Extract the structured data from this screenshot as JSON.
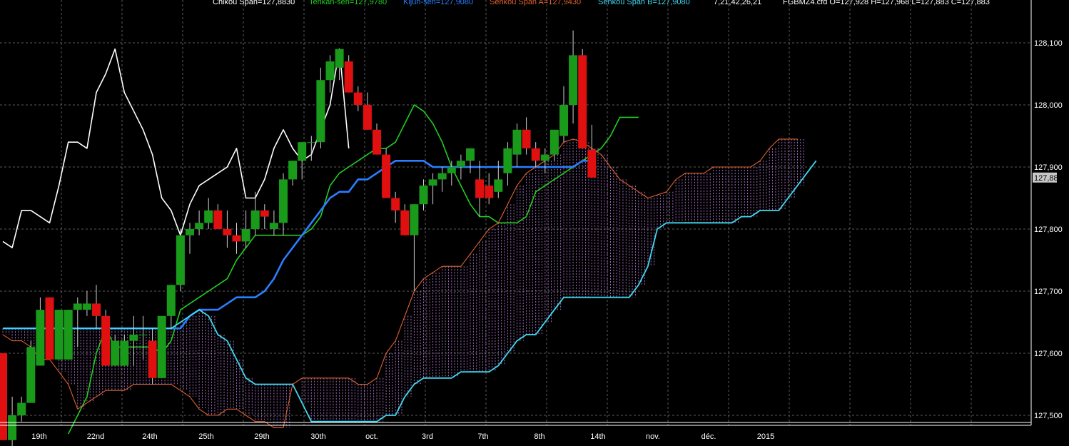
{
  "legend": {
    "chikou": "Chikou Span=127,8830",
    "tenkan": "Tenkan-sen=127,9780",
    "kijun": "Kijun-sen=127,9080",
    "senkou_a": "Senkou Span A=127,9430",
    "senkou_b": "Senkou Span B=127,9080",
    "params": "7,21,42,26,21",
    "ohlc": "FGBMZ4.cfd O=127,928 H=127,968 L=127,883 C=127,883"
  },
  "colors": {
    "background": "#000000",
    "grid": "#5a5a5a",
    "up_candle": "#1a9a1a",
    "down_candle": "#e01010",
    "chikou": "#ffffff",
    "tenkan": "#22cc22",
    "kijun": "#2a7fff",
    "senkou_a": "#e06030",
    "senkou_b": "#40d8f0",
    "cloud_hatch": "#c080e0",
    "axis_text": "#ffffff",
    "last_price_bg": "#c8c8c8"
  },
  "chart_data": {
    "type": "candlestick",
    "instrument": "FGBMZ4.cfd",
    "ylim": [
      127.485,
      128.15
    ],
    "y_ticks": [
      "128,100",
      "128,000",
      "127,900",
      "127,800",
      "127,700",
      "127,600",
      "127,500"
    ],
    "last_price_label": "127,883",
    "x_labels": [
      "19th",
      "22nd",
      "24th",
      "25th",
      "29th",
      "30th",
      "oct.",
      "3rd",
      "7th",
      "8th",
      "14th",
      "nov.",
      "déc.",
      "2015"
    ],
    "grid": true,
    "candles": [
      {
        "o": 127.6,
        "h": 127.6,
        "l": 127.46,
        "c": 127.46
      },
      {
        "o": 127.46,
        "h": 127.53,
        "l": 127.43,
        "c": 127.5
      },
      {
        "o": 127.5,
        "h": 127.53,
        "l": 127.49,
        "c": 127.52
      },
      {
        "o": 127.52,
        "h": 127.62,
        "l": 127.52,
        "c": 127.61
      },
      {
        "o": 127.58,
        "h": 127.69,
        "l": 127.58,
        "c": 127.67
      },
      {
        "o": 127.69,
        "h": 127.69,
        "l": 127.59,
        "c": 127.59
      },
      {
        "o": 127.59,
        "h": 127.67,
        "l": 127.59,
        "c": 127.67
      },
      {
        "o": 127.59,
        "h": 127.67,
        "l": 127.59,
        "c": 127.67
      },
      {
        "o": 127.67,
        "h": 127.69,
        "l": 127.61,
        "c": 127.68
      },
      {
        "o": 127.67,
        "h": 127.7,
        "l": 127.66,
        "c": 127.68
      },
      {
        "o": 127.68,
        "h": 127.71,
        "l": 127.64,
        "c": 127.66
      },
      {
        "o": 127.66,
        "h": 127.67,
        "l": 127.58,
        "c": 127.58
      },
      {
        "o": 127.58,
        "h": 127.63,
        "l": 127.58,
        "c": 127.62
      },
      {
        "o": 127.58,
        "h": 127.63,
        "l": 127.58,
        "c": 127.62
      },
      {
        "o": 127.62,
        "h": 127.66,
        "l": 127.58,
        "c": 127.63
      },
      {
        "o": 127.63,
        "h": 127.66,
        "l": 127.59,
        "c": 127.63
      },
      {
        "o": 127.62,
        "h": 127.64,
        "l": 127.55,
        "c": 127.56
      },
      {
        "o": 127.56,
        "h": 127.66,
        "l": 127.56,
        "c": 127.66
      },
      {
        "o": 127.66,
        "h": 127.71,
        "l": 127.64,
        "c": 127.71
      },
      {
        "o": 127.71,
        "h": 127.8,
        "l": 127.7,
        "c": 127.79
      },
      {
        "o": 127.79,
        "h": 127.81,
        "l": 127.76,
        "c": 127.8
      },
      {
        "o": 127.8,
        "h": 127.83,
        "l": 127.79,
        "c": 127.81
      },
      {
        "o": 127.81,
        "h": 127.85,
        "l": 127.8,
        "c": 127.83
      },
      {
        "o": 127.83,
        "h": 127.84,
        "l": 127.8,
        "c": 127.8
      },
      {
        "o": 127.8,
        "h": 127.83,
        "l": 127.77,
        "c": 127.79
      },
      {
        "o": 127.79,
        "h": 127.81,
        "l": 127.76,
        "c": 127.78
      },
      {
        "o": 127.78,
        "h": 127.83,
        "l": 127.77,
        "c": 127.8
      },
      {
        "o": 127.8,
        "h": 127.86,
        "l": 127.79,
        "c": 127.83
      },
      {
        "o": 127.83,
        "h": 127.84,
        "l": 127.8,
        "c": 127.82
      },
      {
        "o": 127.8,
        "h": 127.83,
        "l": 127.79,
        "c": 127.81
      },
      {
        "o": 127.81,
        "h": 127.89,
        "l": 127.79,
        "c": 127.88
      },
      {
        "o": 127.88,
        "h": 127.91,
        "l": 127.87,
        "c": 127.91
      },
      {
        "o": 127.91,
        "h": 127.94,
        "l": 127.88,
        "c": 127.94
      },
      {
        "o": 127.94,
        "h": 127.95,
        "l": 127.91,
        "c": 127.94
      },
      {
        "o": 127.94,
        "h": 128.06,
        "l": 127.93,
        "c": 128.04
      },
      {
        "o": 128.04,
        "h": 128.08,
        "l": 128.02,
        "c": 128.07
      },
      {
        "o": 128.06,
        "h": 128.09,
        "l": 128.04,
        "c": 128.09
      },
      {
        "o": 128.07,
        "h": 128.08,
        "l": 128.02,
        "c": 128.02
      },
      {
        "o": 128.02,
        "h": 128.03,
        "l": 127.99,
        "c": 128.0
      },
      {
        "o": 128.0,
        "h": 128.02,
        "l": 127.96,
        "c": 127.96
      },
      {
        "o": 127.96,
        "h": 127.97,
        "l": 127.92,
        "c": 127.92
      },
      {
        "o": 127.92,
        "h": 127.93,
        "l": 127.85,
        "c": 127.85
      },
      {
        "o": 127.85,
        "h": 127.86,
        "l": 127.81,
        "c": 127.83
      },
      {
        "o": 127.83,
        "h": 127.84,
        "l": 127.79,
        "c": 127.79
      },
      {
        "o": 127.79,
        "h": 127.84,
        "l": 127.7,
        "c": 127.84
      },
      {
        "o": 127.84,
        "h": 127.88,
        "l": 127.83,
        "c": 127.87
      },
      {
        "o": 127.87,
        "h": 127.89,
        "l": 127.84,
        "c": 127.88
      },
      {
        "o": 127.88,
        "h": 127.9,
        "l": 127.86,
        "c": 127.89
      },
      {
        "o": 127.89,
        "h": 127.91,
        "l": 127.87,
        "c": 127.9
      },
      {
        "o": 127.9,
        "h": 127.92,
        "l": 127.88,
        "c": 127.91
      },
      {
        "o": 127.91,
        "h": 127.93,
        "l": 127.89,
        "c": 127.93
      },
      {
        "o": 127.88,
        "h": 127.91,
        "l": 127.82,
        "c": 127.85
      },
      {
        "o": 127.87,
        "h": 127.89,
        "l": 127.84,
        "c": 127.85
      },
      {
        "o": 127.86,
        "h": 127.91,
        "l": 127.85,
        "c": 127.88
      },
      {
        "o": 127.89,
        "h": 127.94,
        "l": 127.87,
        "c": 127.93
      },
      {
        "o": 127.92,
        "h": 127.97,
        "l": 127.9,
        "c": 127.96
      },
      {
        "o": 127.96,
        "h": 127.98,
        "l": 127.92,
        "c": 127.93
      },
      {
        "o": 127.93,
        "h": 127.94,
        "l": 127.9,
        "c": 127.91
      },
      {
        "o": 127.91,
        "h": 127.93,
        "l": 127.89,
        "c": 127.92
      },
      {
        "o": 127.92,
        "h": 127.96,
        "l": 127.91,
        "c": 127.96
      },
      {
        "o": 127.95,
        "h": 128.03,
        "l": 127.94,
        "c": 128.0
      },
      {
        "o": 128.0,
        "h": 128.12,
        "l": 127.97,
        "c": 128.08
      },
      {
        "o": 128.08,
        "h": 128.09,
        "l": 127.93,
        "c": 127.93
      },
      {
        "o": 127.928,
        "h": 127.968,
        "l": 127.883,
        "c": 127.883
      }
    ],
    "series": [
      {
        "name": "Chikou Span",
        "start": 0,
        "values": [
          127.78,
          127.77,
          127.83,
          127.83,
          127.82,
          127.81,
          127.87,
          127.94,
          127.94,
          127.93,
          128.02,
          128.05,
          128.09,
          128.02,
          127.99,
          127.96,
          127.92,
          127.85,
          127.83,
          127.79,
          127.84,
          127.87,
          127.88,
          127.89,
          127.9,
          127.93,
          127.85,
          127.85,
          127.88,
          127.93,
          127.96,
          127.93,
          127.91,
          127.92,
          127.96,
          128.0,
          128.09,
          127.93
        ]
      },
      {
        "name": "Tenkan-sen",
        "start": 7,
        "values": [
          127.47,
          127.5,
          127.53,
          127.6,
          127.64,
          127.61,
          127.61,
          127.61,
          127.61,
          127.61,
          127.6,
          127.62,
          127.67,
          127.68,
          127.69,
          127.7,
          127.71,
          127.72,
          127.75,
          127.77,
          127.79,
          127.79,
          127.79,
          127.79,
          127.79,
          127.79,
          127.8,
          127.82,
          127.87,
          127.89,
          127.9,
          127.91,
          127.92,
          127.93,
          127.93,
          127.94,
          127.97,
          128.0,
          127.99,
          127.97,
          127.94,
          127.9,
          127.87,
          127.84,
          127.82,
          127.82,
          127.81,
          127.81,
          127.81,
          127.82,
          127.86,
          127.87,
          127.88,
          127.89,
          127.9,
          127.91,
          127.92,
          127.93,
          127.95,
          127.98,
          127.98,
          127.98
        ]
      },
      {
        "name": "Kijun-sen",
        "start": 0,
        "values": [
          127.64,
          127.64,
          127.64,
          127.64,
          127.64,
          127.64,
          127.64,
          127.64,
          127.64,
          127.64,
          127.64,
          127.64,
          127.64,
          127.64,
          127.64,
          127.64,
          127.64,
          127.64,
          127.64,
          127.64,
          127.66,
          127.67,
          127.67,
          127.67,
          127.68,
          127.69,
          127.69,
          127.69,
          127.7,
          127.72,
          127.75,
          127.77,
          127.79,
          127.81,
          127.83,
          127.85,
          127.86,
          127.86,
          127.88,
          127.88,
          127.89,
          127.9,
          127.91,
          127.91,
          127.91,
          127.91,
          127.9,
          127.9,
          127.9,
          127.9,
          127.9,
          127.9,
          127.9,
          127.9,
          127.9,
          127.9,
          127.9,
          127.9,
          127.9,
          127.9,
          127.9,
          127.9,
          127.91,
          127.91
        ]
      },
      {
        "name": "Senkou Span A",
        "start": 0,
        "values": [
          127.63,
          127.62,
          127.62,
          127.61,
          127.59,
          127.59,
          127.57,
          127.55,
          127.51,
          127.52,
          127.53,
          127.54,
          127.54,
          127.54,
          127.55,
          127.55,
          127.55,
          127.55,
          127.55,
          127.54,
          127.53,
          127.51,
          127.5,
          127.5,
          127.51,
          127.51,
          127.5,
          127.49,
          127.49,
          127.48,
          127.48,
          127.55,
          127.56,
          127.56,
          127.56,
          127.56,
          127.56,
          127.56,
          127.55,
          127.55,
          127.56,
          127.6,
          127.62,
          127.66,
          127.7,
          127.72,
          127.73,
          127.74,
          127.74,
          127.74,
          127.76,
          127.78,
          127.8,
          127.81,
          127.84,
          127.87,
          127.89,
          127.9,
          127.91,
          127.92,
          127.94,
          127.945,
          127.94,
          127.93,
          127.92,
          127.9,
          127.88,
          127.87,
          127.86,
          127.85,
          127.855,
          127.86,
          127.88,
          127.89,
          127.89,
          127.89,
          127.9,
          127.9,
          127.9,
          127.9,
          127.9,
          127.91,
          127.93,
          127.945,
          127.945,
          127.945
        ]
      },
      {
        "name": "Senkou Span B",
        "start": 0,
        "values": [
          127.64,
          127.64,
          127.64,
          127.64,
          127.64,
          127.64,
          127.64,
          127.64,
          127.64,
          127.64,
          127.64,
          127.64,
          127.64,
          127.64,
          127.64,
          127.64,
          127.64,
          127.64,
          127.64,
          127.65,
          127.66,
          127.67,
          127.66,
          127.63,
          127.62,
          127.59,
          127.56,
          127.55,
          127.55,
          127.55,
          127.55,
          127.55,
          127.52,
          127.49,
          127.49,
          127.49,
          127.49,
          127.49,
          127.49,
          127.49,
          127.49,
          127.5,
          127.5,
          127.53,
          127.55,
          127.56,
          127.56,
          127.56,
          127.56,
          127.57,
          127.57,
          127.57,
          127.57,
          127.58,
          127.6,
          127.62,
          127.63,
          127.63,
          127.65,
          127.67,
          127.69,
          127.69,
          127.69,
          127.69,
          127.69,
          127.69,
          127.69,
          127.69,
          127.71,
          127.74,
          127.8,
          127.81,
          127.81,
          127.81,
          127.81,
          127.81,
          127.81,
          127.81,
          127.81,
          127.82,
          127.82,
          127.83,
          127.83,
          127.83,
          127.85,
          127.87,
          127.89,
          127.91
        ]
      }
    ]
  }
}
